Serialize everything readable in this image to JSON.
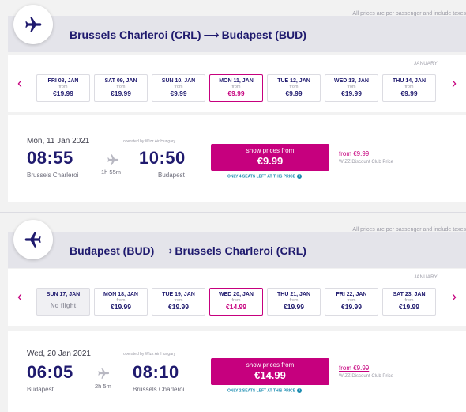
{
  "outbound": {
    "notice": "All prices are per passenger and include taxes",
    "route": {
      "origin": "Brussels Charleroi (CRL)",
      "arrow": "⟶",
      "destination": "Budapest (BUD)"
    },
    "month": "JANUARY",
    "days": [
      {
        "label": "FRI 08, JAN",
        "from": "from",
        "price": "€19.99",
        "selected": false
      },
      {
        "label": "SAT 09, JAN",
        "from": "from",
        "price": "€19.99",
        "selected": false
      },
      {
        "label": "SUN 10, JAN",
        "from": "from",
        "price": "€9.99",
        "selected": false
      },
      {
        "label": "MON 11, JAN",
        "from": "from",
        "price": "€9.99",
        "selected": true
      },
      {
        "label": "TUE 12, JAN",
        "from": "from",
        "price": "€9.99",
        "selected": false
      },
      {
        "label": "WED 13, JAN",
        "from": "from",
        "price": "€19.99",
        "selected": false
      },
      {
        "label": "THU 14, JAN",
        "from": "from",
        "price": "€9.99",
        "selected": false
      }
    ],
    "flight": {
      "date": "Mon, 11 Jan 2021",
      "operated_by": "operated by Wizz Air Hungary",
      "dep_time": "08:55",
      "dep_city": "Brussels Charleroi",
      "duration": "1h 55m",
      "arr_time": "10:50",
      "arr_city": "Budapest",
      "button_label": "show prices from",
      "button_price": "€9.99",
      "seats_left": "ONLY 4 SEATS LEFT AT THIS PRICE",
      "club_price": "from €9.99",
      "club_label": "WIZZ Discount Club Price"
    }
  },
  "return": {
    "notice": "All prices are per passenger and include taxes",
    "route": {
      "origin": "Budapest (BUD)",
      "arrow": "⟶",
      "destination": "Brussels Charleroi (CRL)"
    },
    "month": "JANUARY",
    "days": [
      {
        "label": "SUN 17, JAN",
        "no_flight": "No flight",
        "selected": false
      },
      {
        "label": "MON 18, JAN",
        "from": "from",
        "price": "€19.99",
        "selected": false
      },
      {
        "label": "TUE 19, JAN",
        "from": "from",
        "price": "€19.99",
        "selected": false
      },
      {
        "label": "WED 20, JAN",
        "from": "from",
        "price": "€14.99",
        "selected": true
      },
      {
        "label": "THU 21, JAN",
        "from": "from",
        "price": "€19.99",
        "selected": false
      },
      {
        "label": "FRI 22, JAN",
        "from": "from",
        "price": "€19.99",
        "selected": false
      },
      {
        "label": "SAT 23, JAN",
        "from": "from",
        "price": "€19.99",
        "selected": false
      }
    ],
    "flight": {
      "date": "Wed, 20 Jan 2021",
      "operated_by": "operated by Wizz Air Hungary",
      "dep_time": "06:05",
      "dep_city": "Budapest",
      "duration": "2h 5m",
      "arr_time": "08:10",
      "arr_city": "Brussels Charleroi",
      "button_label": "show prices from",
      "button_price": "€14.99",
      "seats_left": "ONLY 2 SEATS LEFT AT THIS PRICE",
      "club_price": "from €9.99",
      "club_label": "WIZZ Discount Club Price"
    }
  },
  "icons": {
    "plane": "airplane-icon",
    "prev": "chevron-left-icon",
    "next": "chevron-right-icon",
    "info": "info-icon"
  },
  "colors": {
    "brand": "#c6007e",
    "navy": "#1f1a6e",
    "info": "#1a8cb0"
  }
}
